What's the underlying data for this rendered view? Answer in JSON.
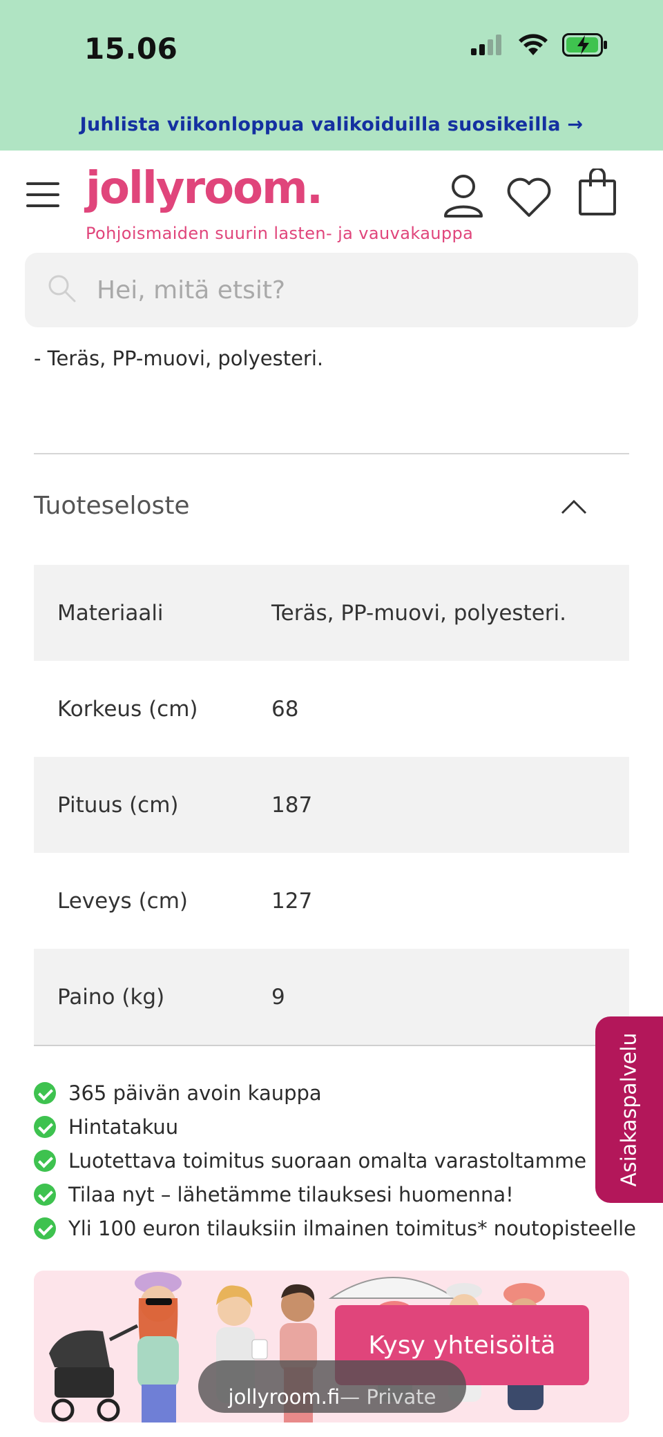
{
  "status_bar": {
    "time": "15.06",
    "icons": [
      "signal-icon",
      "wifi-icon",
      "battery-charging-icon"
    ]
  },
  "promo": {
    "text": "Juhlista viikonloppua valikoiduilla suosikeilla →",
    "color": "#1430a0"
  },
  "header": {
    "logo": "jollyroom.",
    "tagline": "Pohjoismaiden suurin lasten- ja vauvakauppa",
    "brand_color": "#e0457b",
    "icons": [
      "menu-icon",
      "account-icon",
      "wishlist-icon",
      "cart-icon"
    ]
  },
  "search": {
    "placeholder": "Hei, mitä etsit?"
  },
  "material_note": "- Teräs, PP-muovi, polyesteri.",
  "product_specs": {
    "title": "Tuoteseloste",
    "expanded": true,
    "rows": [
      {
        "key": "Materiaali",
        "value": "Teräs, PP-muovi, polyesteri."
      },
      {
        "key": "Korkeus (cm)",
        "value": "68"
      },
      {
        "key": "Pituus (cm)",
        "value": "187"
      },
      {
        "key": "Leveys (cm)",
        "value": "127"
      },
      {
        "key": "Paino (kg)",
        "value": "9"
      }
    ]
  },
  "benefits": [
    "365 päivän avoin kauppa",
    "Hintatakuu",
    "Luotettava toimitus suoraan omalta varastoltamme",
    "Tilaa nyt – lähetämme tilauksesi huomenna!",
    "Yli 100 euron tilauksiin ilmainen toimitus* noutopisteelle"
  ],
  "customer_service": {
    "label": "Asiakaspalvelu",
    "color": "#b3175a"
  },
  "community": {
    "button_label": "Kysy yhteisöltä"
  },
  "browser": {
    "domain": "jollyroom.fi",
    "mode": " — Private"
  }
}
